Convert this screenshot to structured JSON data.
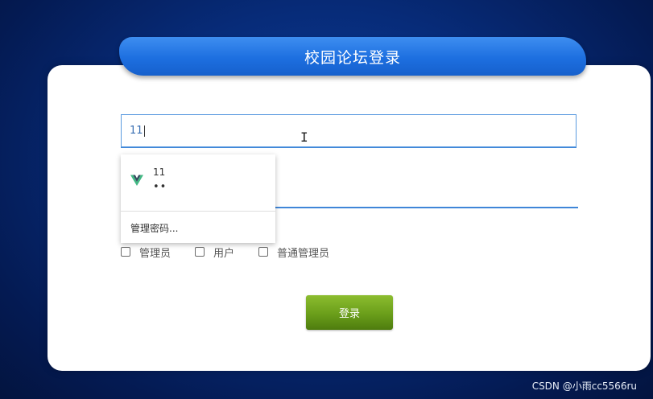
{
  "header": {
    "title": "校园论坛登录"
  },
  "username": {
    "value": "11"
  },
  "autofill": {
    "entry_username": "11",
    "entry_password_mask": "••",
    "manage_label": "管理密码..."
  },
  "roles": [
    {
      "label": "管理员",
      "checked": false
    },
    {
      "label": "用户",
      "checked": false
    },
    {
      "label": "普通管理员",
      "checked": false
    }
  ],
  "login_button": {
    "label": "登录"
  },
  "watermark": {
    "text": "CSDN @小雨cc5566ru"
  },
  "colors": {
    "header_blue": "#1d6fe0",
    "login_green": "#6a9e1a",
    "input_border": "#5b9be0"
  }
}
